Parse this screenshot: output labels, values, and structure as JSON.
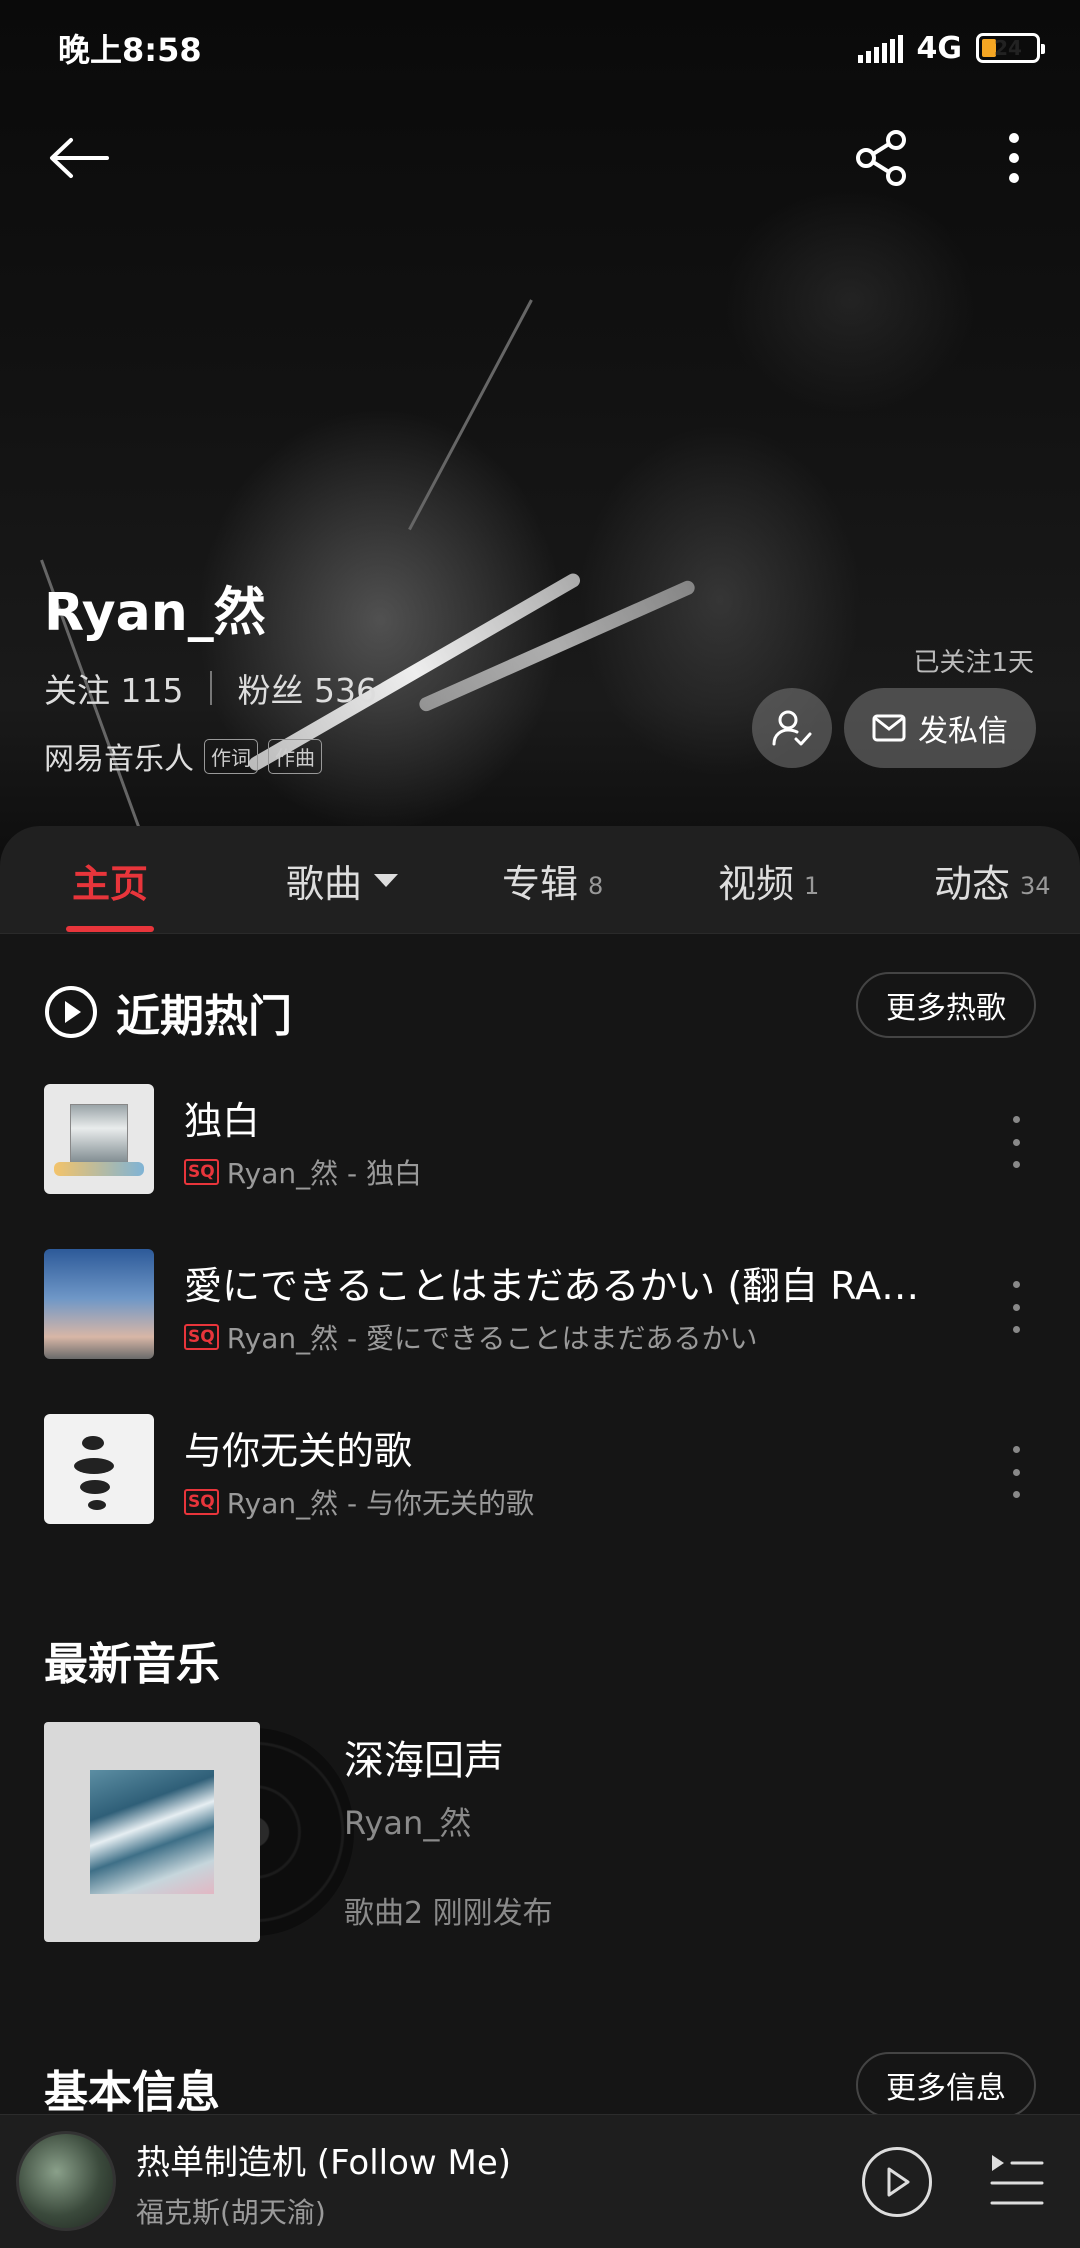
{
  "status_bar": {
    "time": "晚上8:58",
    "network": "4G",
    "battery": "24"
  },
  "artist": {
    "name": "Ryan_然",
    "following_label": "关注",
    "following_count": "115",
    "fans_label": "粉丝",
    "fans_count": "536",
    "identity": "网易音乐人",
    "tags": [
      "作词",
      "作曲"
    ],
    "followed_days": "已关注1天",
    "message_label": "发私信"
  },
  "tabs": [
    {
      "label": "主页",
      "count": ""
    },
    {
      "label": "歌曲",
      "count": ""
    },
    {
      "label": "专辑",
      "count": "8"
    },
    {
      "label": "视频",
      "count": "1"
    },
    {
      "label": "动态",
      "count": "34"
    }
  ],
  "hot": {
    "title": "近期热门",
    "more_label": "更多热歌",
    "quality_badge": "SQ",
    "songs": [
      {
        "title": "独白",
        "sub": "Ryan_然 - 独白"
      },
      {
        "title": "愛にできることはまだあるかい (翻自 RA…",
        "sub": "Ryan_然 - 愛にできることはまだあるかい"
      },
      {
        "title": "与你无关的歌",
        "sub": "Ryan_然 - 与你无关的歌"
      }
    ]
  },
  "latest": {
    "title": "最新音乐",
    "album_title": "深海回声",
    "album_artist": "Ryan_然",
    "album_meta": "歌曲2 刚刚发布"
  },
  "basic_info": {
    "title": "基本信息",
    "more_label": "更多信息"
  },
  "mini_player": {
    "title": "热单制造机 (Follow Me)",
    "artist": "福克斯(胡天渝)"
  },
  "colors": {
    "accent": "#e8353b",
    "background": "#151515"
  }
}
